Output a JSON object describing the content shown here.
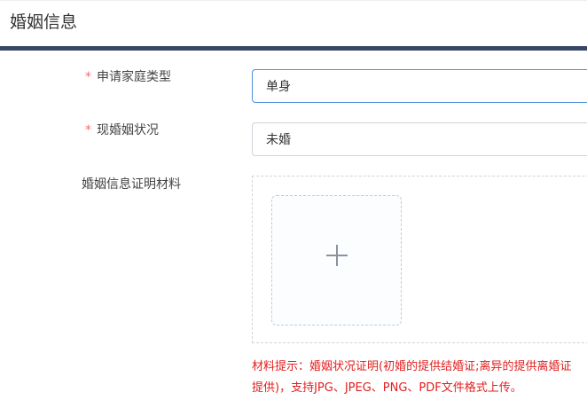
{
  "section": {
    "title": "婚姻信息"
  },
  "form": {
    "family_type": {
      "required_mark": "*",
      "label": "申请家庭类型",
      "value": "单身"
    },
    "marital_status": {
      "required_mark": "*",
      "label": "现婚姻状况",
      "value": "未婚"
    },
    "proof_materials": {
      "label": "婚姻信息证明材料",
      "upload_icon": "plus-icon"
    },
    "hint_line1": "材料提示：婚姻状况证明(初婚的提供结婚证;离异的提供离婚证",
    "hint_line2": "提供)，支持JPG、JPEG、PNG、PDF文件格式上传。"
  },
  "colors": {
    "accent_bar": "#374766",
    "required": "#f56c6c",
    "hint": "#e02020",
    "focus_border": "#4d8fe0"
  }
}
